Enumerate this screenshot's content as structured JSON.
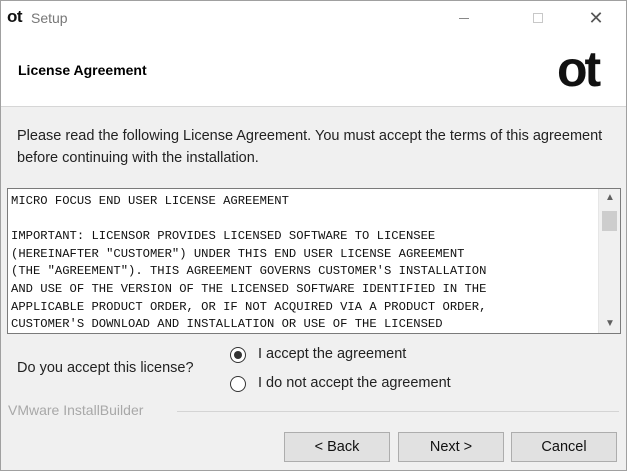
{
  "window": {
    "logo": "ot",
    "title": "Setup"
  },
  "header": {
    "title": "License Agreement",
    "logo": "ot"
  },
  "intro": "Please read the following License Agreement. You must accept the terms of this agreement before continuing with the installation.",
  "license": {
    "lines": [
      "MICRO FOCUS END USER LICENSE AGREEMENT",
      "",
      "IMPORTANT: LICENSOR PROVIDES LICENSED SOFTWARE TO LICENSEE",
      "(HEREINAFTER \"CUSTOMER\") UNDER THIS END USER LICENSE AGREEMENT",
      "(THE \"AGREEMENT\"). THIS AGREEMENT GOVERNS CUSTOMER'S INSTALLATION",
      "AND USE OF THE VERSION OF THE LICENSED SOFTWARE IDENTIFIED IN THE",
      "APPLICABLE PRODUCT ORDER, OR IF NOT ACQUIRED VIA A PRODUCT ORDER,",
      "CUSTOMER'S DOWNLOAD AND INSTALLATION OR USE OF THE LICENSED"
    ]
  },
  "accept": {
    "question": "Do you accept this license?",
    "options": [
      {
        "label": "I accept the agreement",
        "selected": true
      },
      {
        "label": "I do not accept the agreement",
        "selected": false
      }
    ]
  },
  "footer": {
    "brand": "VMware InstallBuilder",
    "back_label": "< Back",
    "next_label": "Next >",
    "cancel_label": "Cancel"
  }
}
